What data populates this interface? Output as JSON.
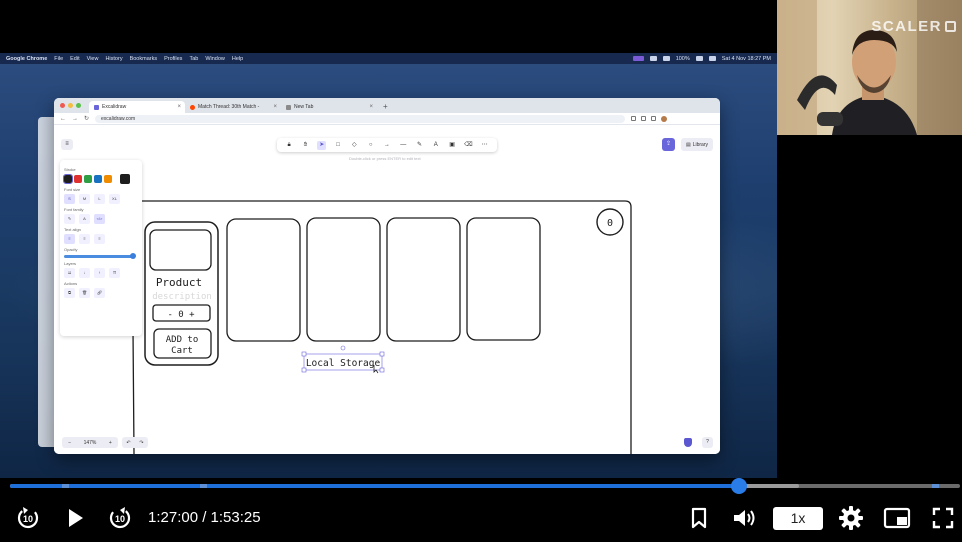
{
  "mac_menubar": {
    "items": [
      "Google Chrome",
      "File",
      "Edit",
      "View",
      "History",
      "Bookmarks",
      "Profiles",
      "Tab",
      "Window",
      "Help"
    ],
    "battery": "100%",
    "datetime": "Sat 4 Nov 18:27 PM"
  },
  "browser": {
    "tabs": [
      {
        "label": "Excalidraw",
        "color": "#6965db"
      },
      {
        "label": "Match Thread: 30th Match - ",
        "color": "#ff4500"
      },
      {
        "label": "New Tab",
        "color": "#8a8a8a"
      }
    ],
    "address": "excalidraw.com"
  },
  "excalidraw": {
    "toolbar_hint": "Double-click or press ENTER to edit text",
    "library_label": "Library",
    "props": {
      "stroke_label": "Stroke",
      "stroke_colors": [
        "#1e1e1e",
        "#e03131",
        "#2f9e44",
        "#1971c2",
        "#f08c00"
      ],
      "selected_stroke": "#1e1e1e",
      "font_size_label": "Font size",
      "font_sizes": [
        "S",
        "M",
        "L",
        "XL"
      ],
      "font_family_label": "Font family",
      "text_align_label": "Text align",
      "opacity_label": "Opacity",
      "opacity": 1.0,
      "layers_label": "Layers",
      "actions_label": "Actions"
    },
    "zoom": "147%",
    "drawing": {
      "product_title": "Product",
      "product_description": "description",
      "qty_text": "- 0 +",
      "add_to_cart_line1": "ADD to",
      "add_to_cart_line2": "Cart",
      "cart_count": "0",
      "local_storage": "Local Storage"
    }
  },
  "webcam": {
    "brand": "SCALER"
  },
  "player": {
    "current_time": "1:27:00",
    "duration": "1:53:25",
    "time_text": "1:27:00 / 1:53:25",
    "played_fraction": 0.767,
    "buffered_fraction": 0.83,
    "chapter_fractions": [
      0.055,
      0.2,
      0.97
    ],
    "speed": "1x",
    "colors": {
      "accent": "#2a7de8",
      "track": "#6b6b6b"
    }
  }
}
